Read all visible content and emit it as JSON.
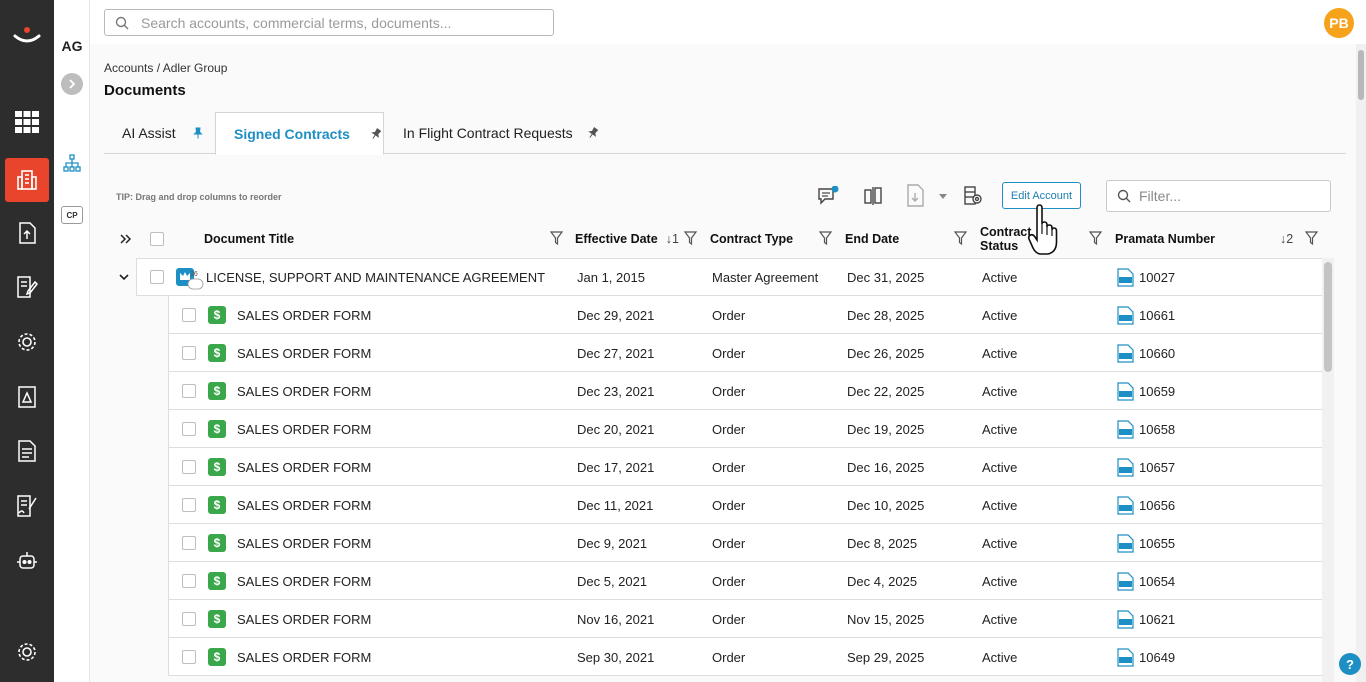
{
  "account_initials": "AG",
  "cp_label": "CP",
  "user_initials": "PB",
  "search": {
    "placeholder": "Search accounts, commercial terms, documents..."
  },
  "breadcrumb": "Accounts / Adler Group",
  "page_title": "Documents",
  "tabs": [
    {
      "label": "AI Assist",
      "active": false
    },
    {
      "label": "Signed Contracts",
      "active": true
    },
    {
      "label": "In Flight Contract Requests",
      "active": false
    }
  ],
  "tip": "TIP: Drag and drop columns to reorder",
  "toolbar": {
    "edit_account": "Edit Account",
    "filter_placeholder": "Filter..."
  },
  "columns": {
    "title": "Document Title",
    "effective": "Effective Date",
    "effective_sort": "1",
    "type": "Contract Type",
    "end": "End Date",
    "status": "Contract Status",
    "number": "Pramata Number",
    "number_sort": "2"
  },
  "parent": {
    "title": "LICENSE, SUPPORT AND MAINTENANCE AGREEMENT",
    "badge": "36",
    "effective": "Jan 1, 2015",
    "type": "Master Agreement",
    "end": "Dec 31, 2025",
    "status": "Active",
    "number": "10027"
  },
  "rows": [
    {
      "title": "SALES ORDER FORM",
      "effective": "Dec 29, 2021",
      "type": "Order",
      "end": "Dec 28, 2025",
      "status": "Active",
      "number": "10661"
    },
    {
      "title": "SALES ORDER FORM",
      "effective": "Dec 27, 2021",
      "type": "Order",
      "end": "Dec 26, 2025",
      "status": "Active",
      "number": "10660"
    },
    {
      "title": "SALES ORDER FORM",
      "effective": "Dec 23, 2021",
      "type": "Order",
      "end": "Dec 22, 2025",
      "status": "Active",
      "number": "10659"
    },
    {
      "title": "SALES ORDER FORM",
      "effective": "Dec 20, 2021",
      "type": "Order",
      "end": "Dec 19, 2025",
      "status": "Active",
      "number": "10658"
    },
    {
      "title": "SALES ORDER FORM",
      "effective": "Dec 17, 2021",
      "type": "Order",
      "end": "Dec 16, 2025",
      "status": "Active",
      "number": "10657"
    },
    {
      "title": "SALES ORDER FORM",
      "effective": "Dec 11, 2021",
      "type": "Order",
      "end": "Dec 10, 2025",
      "status": "Active",
      "number": "10656"
    },
    {
      "title": "SALES ORDER FORM",
      "effective": "Dec 9, 2021",
      "type": "Order",
      "end": "Dec 8, 2025",
      "status": "Active",
      "number": "10655"
    },
    {
      "title": "SALES ORDER FORM",
      "effective": "Dec 5, 2021",
      "type": "Order",
      "end": "Dec 4, 2025",
      "status": "Active",
      "number": "10654"
    },
    {
      "title": "SALES ORDER FORM",
      "effective": "Nov 16, 2021",
      "type": "Order",
      "end": "Nov 15, 2025",
      "status": "Active",
      "number": "10621"
    },
    {
      "title": "SALES ORDER FORM",
      "effective": "Sep 30, 2021",
      "type": "Order",
      "end": "Sep 29, 2025",
      "status": "Active",
      "number": "10649"
    }
  ],
  "help_label": "?",
  "colors": {
    "accent": "#1e8fc4",
    "brand": "#e8452c",
    "rail": "#2d2d2d",
    "avatar": "#f7a21b",
    "dollar": "#3aa84a"
  },
  "icons": {
    "rail": [
      "grid-icon",
      "accounts-icon",
      "upload-icon",
      "contract-edit-icon",
      "gear-icon",
      "report-icon",
      "document-icon",
      "sign-icon",
      "bot-icon",
      "settings-icon"
    ]
  }
}
